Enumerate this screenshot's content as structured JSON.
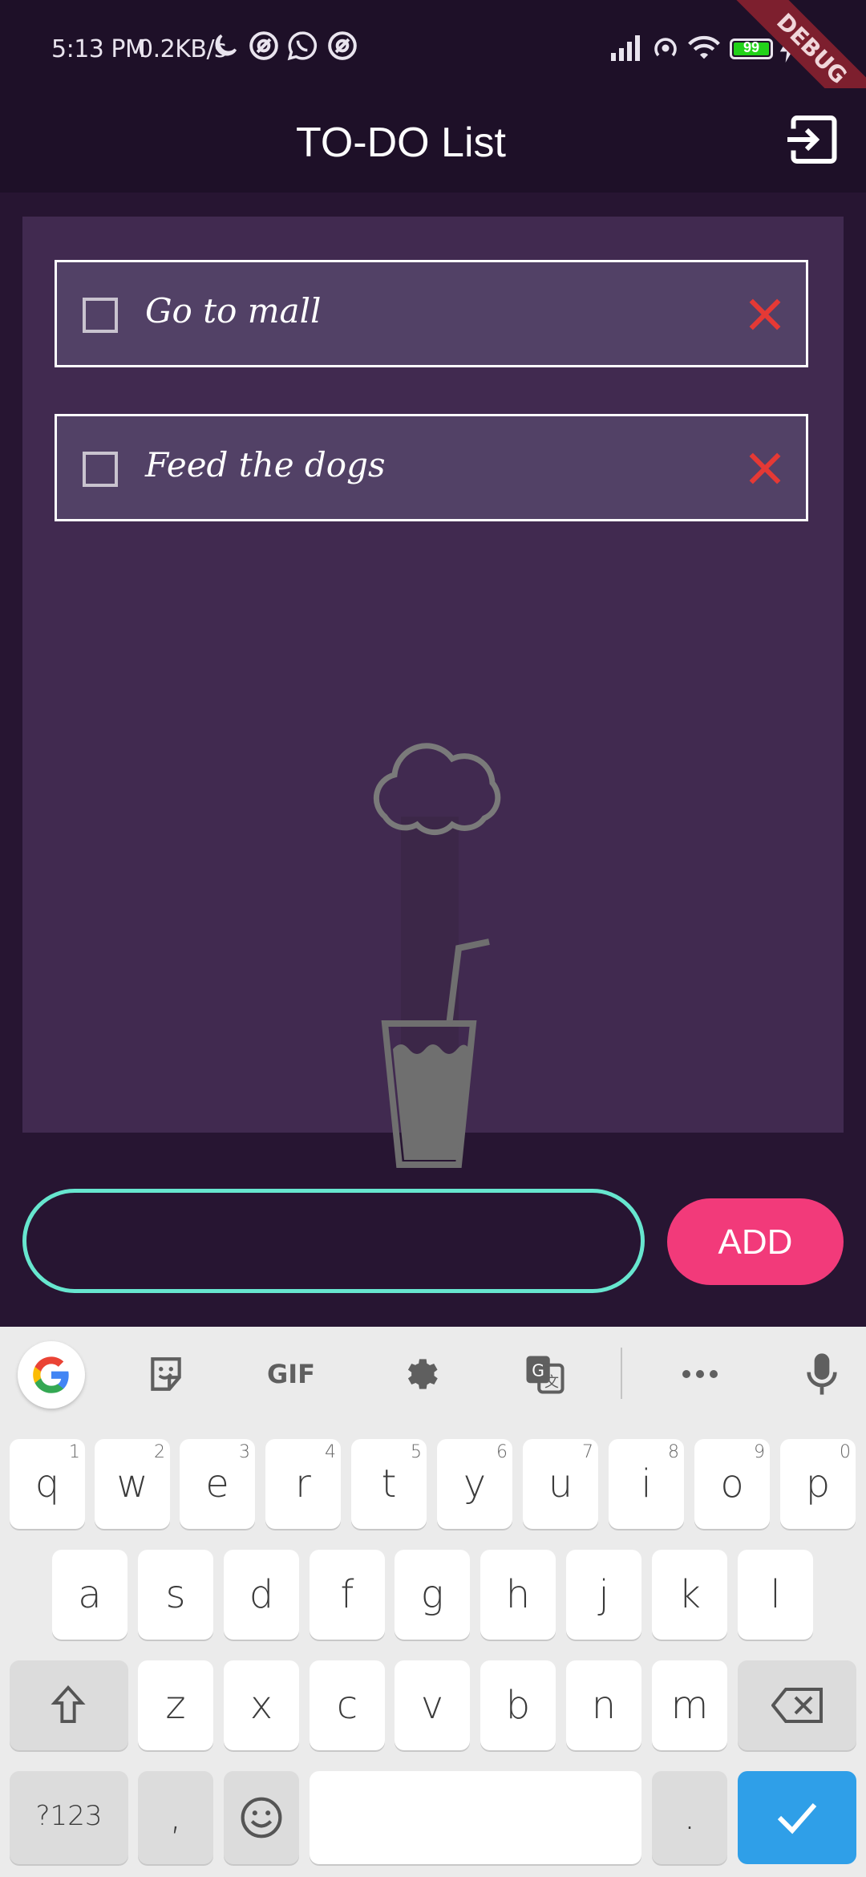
{
  "status_bar": {
    "time": "5:13 PM",
    "net_speed": "0.2KB/s",
    "battery": "99",
    "debug_label": "DEBUG",
    "icons": [
      "moon-icon",
      "at-icon",
      "whatsapp-icon",
      "at-icon",
      "signal-icon",
      "hotspot-icon",
      "wifi-icon",
      "battery-icon",
      "charging-icon"
    ]
  },
  "app_bar": {
    "title": "TO-DO List",
    "action_icon": "logout-icon"
  },
  "todos": [
    {
      "text": "Go to mall",
      "checked": false
    },
    {
      "text": "Feed the dogs",
      "checked": false
    }
  ],
  "input": {
    "value": "",
    "placeholder": ""
  },
  "add_button": {
    "label": "ADD"
  },
  "colors": {
    "background": "#271532",
    "panel": "#412a50",
    "item_bg": "#524166",
    "input_border": "#67e6cf",
    "add_button": "#f23a7a",
    "delete_icon": "#e53935"
  },
  "keyboard": {
    "toolbar": [
      "google-icon",
      "sticker-icon",
      "gif-icon",
      "settings-icon",
      "translate-icon",
      "more-icon",
      "mic-icon"
    ],
    "gif_label": "GIF",
    "row1": [
      {
        "k": "q",
        "h": "1"
      },
      {
        "k": "w",
        "h": "2"
      },
      {
        "k": "e",
        "h": "3"
      },
      {
        "k": "r",
        "h": "4"
      },
      {
        "k": "t",
        "h": "5"
      },
      {
        "k": "y",
        "h": "6"
      },
      {
        "k": "u",
        "h": "7"
      },
      {
        "k": "i",
        "h": "8"
      },
      {
        "k": "o",
        "h": "9"
      },
      {
        "k": "p",
        "h": "0"
      }
    ],
    "row2": [
      "a",
      "s",
      "d",
      "f",
      "g",
      "h",
      "j",
      "k",
      "l"
    ],
    "row3": [
      "z",
      "x",
      "c",
      "v",
      "b",
      "n",
      "m"
    ],
    "symbols_label": "?123",
    "comma": ",",
    "period": "."
  }
}
